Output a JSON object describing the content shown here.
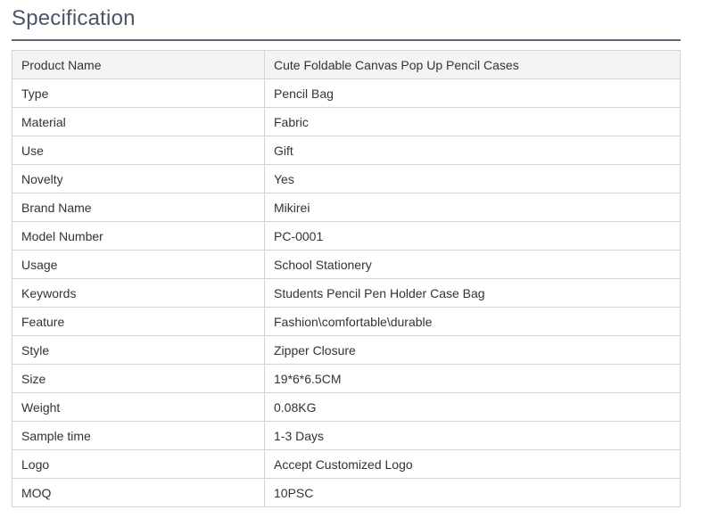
{
  "title": "Specification",
  "rows": [
    {
      "label": "Product Name",
      "value": "Cute Foldable Canvas Pop Up Pencil Cases"
    },
    {
      "label": "Type",
      "value": "Pencil Bag"
    },
    {
      "label": "Material",
      "value": "Fabric"
    },
    {
      "label": "Use",
      "value": "Gift"
    },
    {
      "label": "Novelty",
      "value": "Yes"
    },
    {
      "label": "Brand Name",
      "value": "Mikirei"
    },
    {
      "label": "Model Number",
      "value": "PC-0001"
    },
    {
      "label": "Usage",
      "value": "School Stationery"
    },
    {
      "label": "Keywords",
      "value": "Students Pencil Pen Holder Case Bag"
    },
    {
      "label": "Feature",
      "value": "Fashion\\comfortable\\durable"
    },
    {
      "label": "Style",
      "value": "Zipper Closure"
    },
    {
      "label": "Size",
      "value": "19*6*6.5CM"
    },
    {
      "label": "Weight",
      "value": "0.08KG"
    },
    {
      "label": "Sample time",
      "value": "1-3 Days"
    },
    {
      "label": "Logo",
      "value": "Accept Customized Logo"
    },
    {
      "label": "MOQ",
      "value": "10PSC"
    }
  ],
  "colors": {
    "title": "#4a5566",
    "rule": "#5f6877",
    "border": "#d4d4d4",
    "header_row_bg": "#f4f4f4",
    "text": "#333333"
  }
}
